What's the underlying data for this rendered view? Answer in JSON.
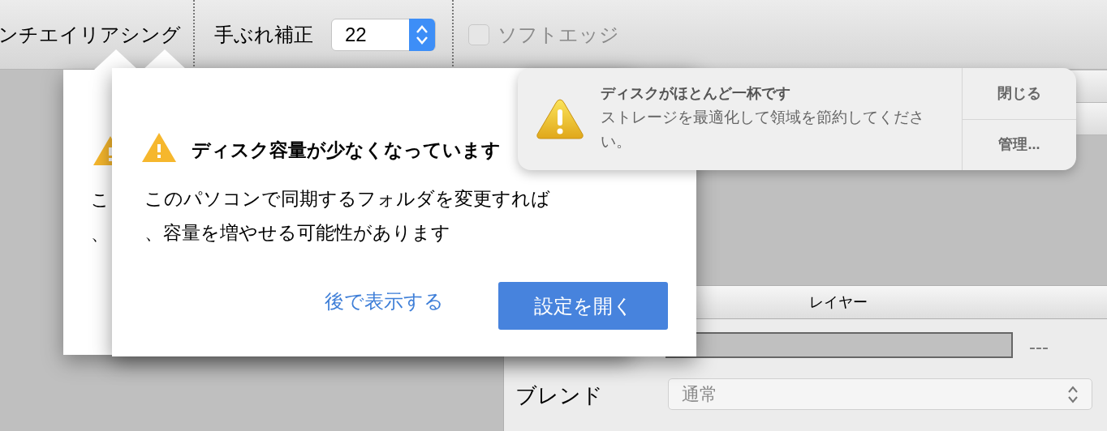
{
  "toolbar": {
    "antialias_label": "ンチエイリアシング",
    "stabilizer": {
      "label": "手ぶれ補正",
      "value": "22"
    },
    "soft_edge": {
      "label": "ソフトエッジ",
      "checked": false,
      "disabled": true
    }
  },
  "back_dialog": {
    "lines": [
      "こ",
      "、"
    ]
  },
  "dialog": {
    "title": "ディスク容量が少なくなっています",
    "lines": [
      "このパソコンで同期するフォルダを変更すれば",
      "、容量を増やせる可能性があります"
    ],
    "secondary_button": "後で表示する",
    "primary_button": "設定を開く"
  },
  "notification": {
    "title": "ディスクがほとんど一杯です",
    "body": "ストレージを最適化して領域を節約してください。",
    "buttons": [
      "閉じる",
      "管理..."
    ]
  },
  "layer_panel": {
    "header": "レイヤー",
    "opacity_reading": "---",
    "blend_label": "ブレンド",
    "blend_value": "通常"
  }
}
